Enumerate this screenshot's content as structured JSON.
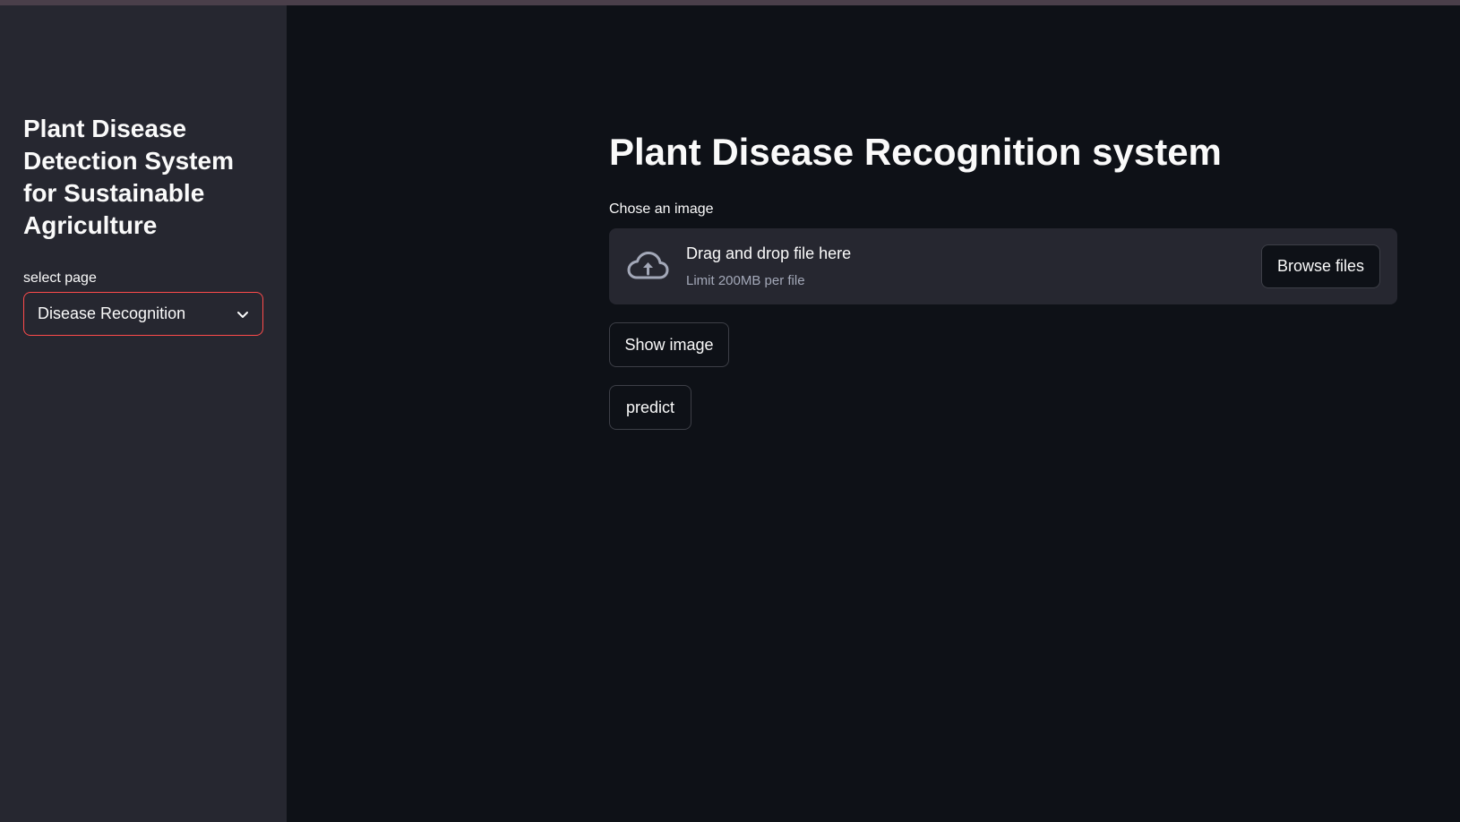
{
  "sidebar": {
    "title": "Plant Disease Detection System for Sustainable Agriculture",
    "select_label": "select page",
    "select_value": "Disease Recognition"
  },
  "main": {
    "title": "Plant Disease Recognition system",
    "uploader": {
      "label": "Chose an image",
      "drag_text": "Drag and drop file here",
      "limit_text": "Limit 200MB per file",
      "browse_label": "Browse files"
    },
    "show_image_label": "Show image",
    "predict_label": "predict"
  },
  "colors": {
    "background": "#0e1117",
    "sidebar": "#262730",
    "accent": "#ff4b4b"
  },
  "icons": {
    "upload": "cloud-upload-icon",
    "dropdown": "chevron-down-icon"
  }
}
